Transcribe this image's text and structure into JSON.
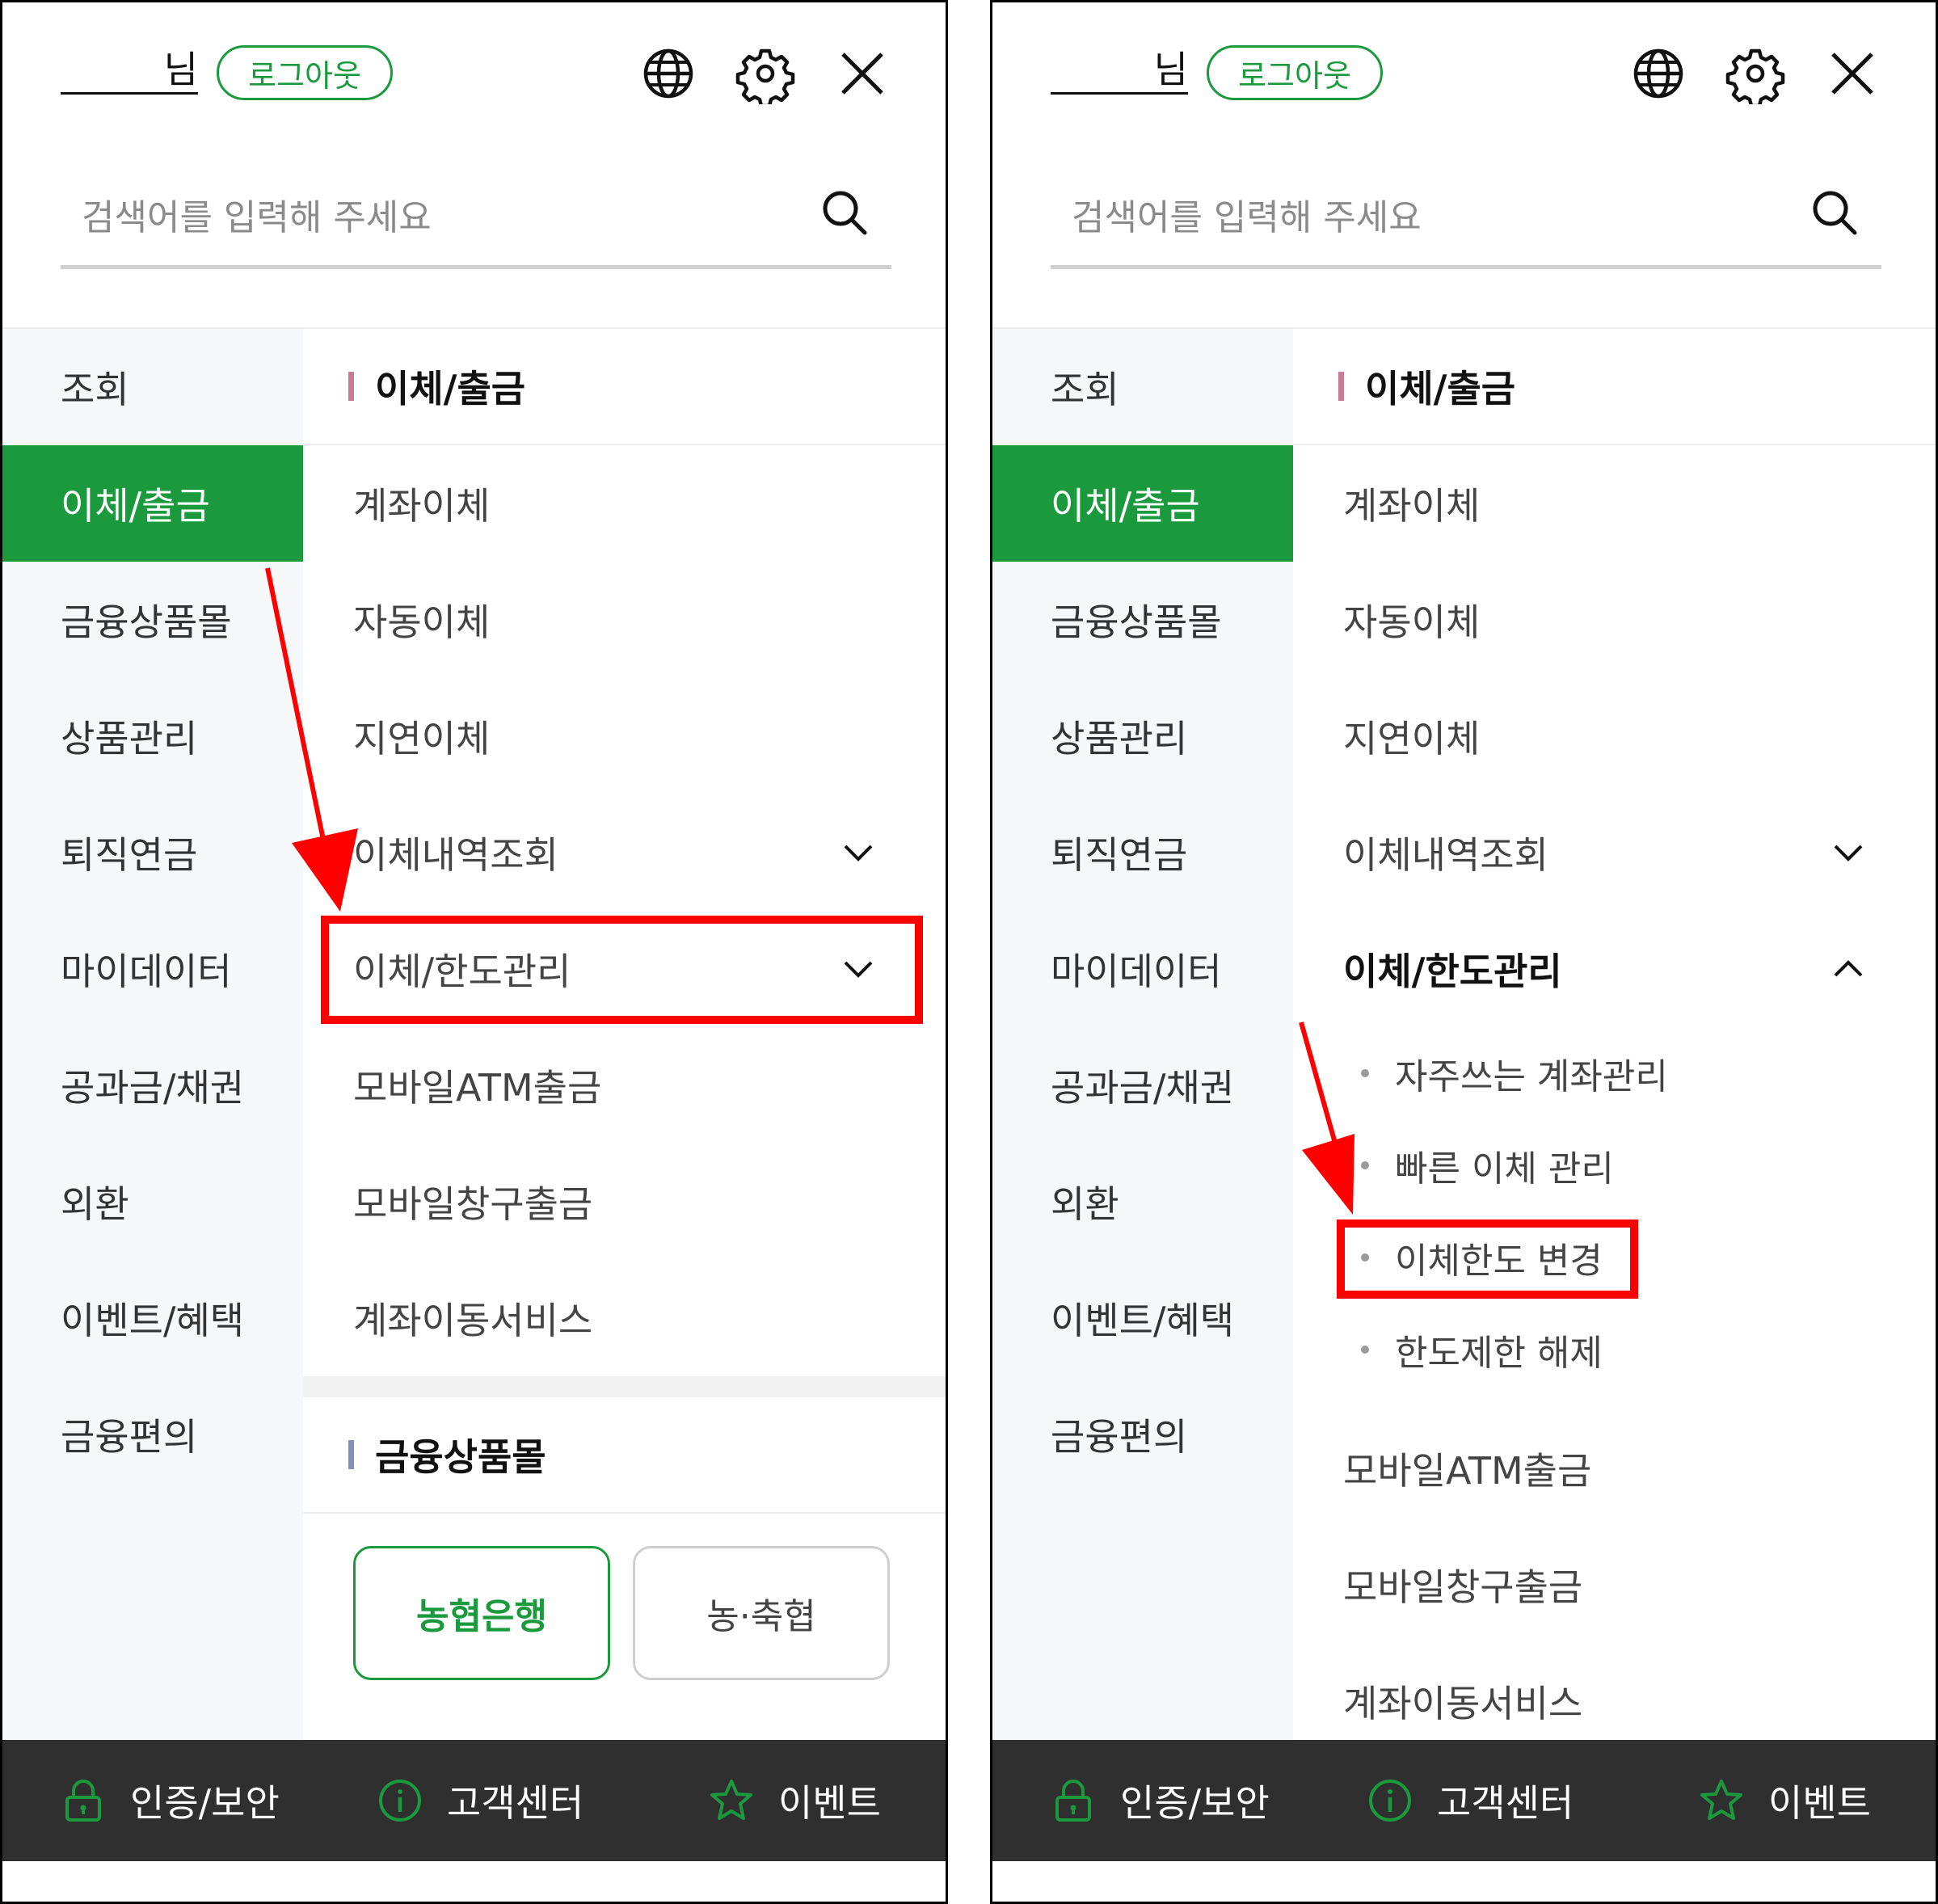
{
  "header": {
    "user_suffix": "님",
    "logout_label": "로그아웃",
    "icons": [
      "globe-icon",
      "gear-icon",
      "close-icon"
    ]
  },
  "search": {
    "placeholder": "검색어를 입력해 주세요"
  },
  "nav": {
    "items": [
      "조회",
      "이체/출금",
      "금융상품몰",
      "상품관리",
      "퇴직연금",
      "마이데이터",
      "공과금/채권",
      "외환",
      "이벤트/혜택",
      "금융편의"
    ],
    "active_index": 1
  },
  "submenu": {
    "section_title": "이체/출금",
    "items": [
      "계좌이체",
      "자동이체",
      "지연이체",
      "이체내역조회",
      "이체/한도관리",
      "모바일ATM출금",
      "모바일창구출금",
      "계좌이동서비스"
    ],
    "expanded_children": [
      "자주쓰는 계좌관리",
      "빠른 이체 관리",
      "이체한도 변경",
      "한도제한 해제"
    ],
    "section2_title": "금융상품몰",
    "banks": [
      "농협은행",
      "농·축협"
    ]
  },
  "footer": {
    "items": [
      "인증/보안",
      "고객센터",
      "이벤트"
    ]
  },
  "colors": {
    "brand_green": "#1a9a3d",
    "highlight_red": "#ff0000",
    "footer_bg": "#2f2f2f",
    "section_bar_pink": "#c97b93",
    "section_bar_blue": "#8090b8"
  }
}
